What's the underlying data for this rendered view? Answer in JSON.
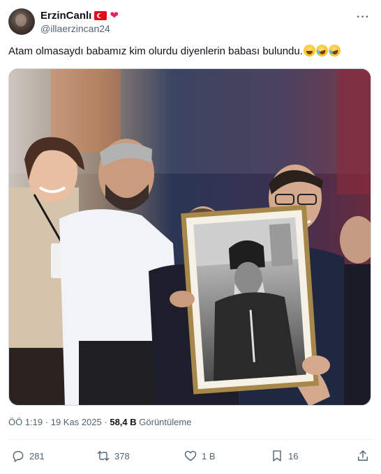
{
  "author": {
    "display_name": "ErzinCanlı",
    "handle": "@illaerzincan24",
    "avatar_icon": "profile-photo",
    "flag_icon": "turkey-flag-icon",
    "heart_icon": "red-heart-icon"
  },
  "tweet": {
    "text": "Atam olmasaydı babamız kim olurdu diyenlerin babası bulundu.",
    "emojis": [
      "grinning-face-icon",
      "rolling-laughing-icon",
      "rolling-laughing-icon"
    ]
  },
  "media": {
    "kind": "photo",
    "description_icon": "group-photo-with-framed-portrait"
  },
  "meta": {
    "time": "ÖÖ 1:19",
    "separator": "·",
    "date": "19 Kas 2025",
    "views_count": "58,4 B",
    "views_label": "Görüntüleme"
  },
  "actions": {
    "replies": "281",
    "reposts": "378",
    "likes": "1 B",
    "bookmarks": "16"
  },
  "colors": {
    "text": "#0f1419",
    "secondary": "#536471",
    "divider": "#eff3f4",
    "flag_red": "#e30a17",
    "heart_red": "#e0245e"
  }
}
